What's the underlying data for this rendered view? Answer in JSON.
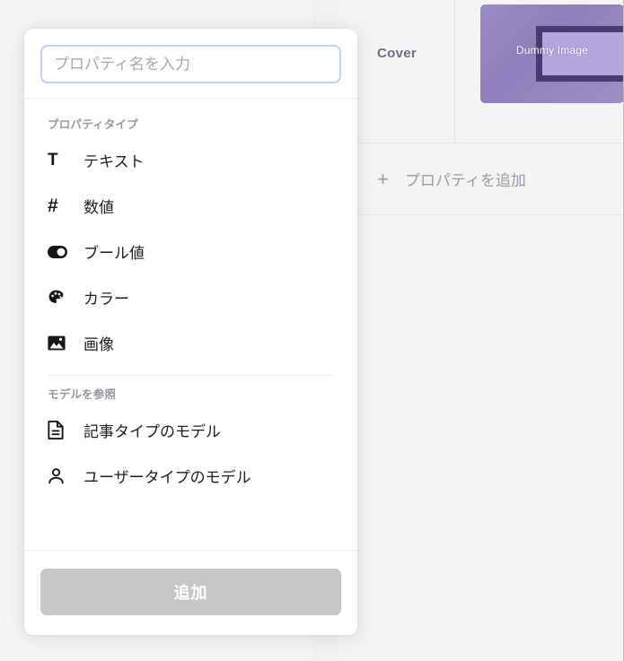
{
  "background": {
    "cover_row": {
      "label": "Cover",
      "image_caption": "Dummy Image"
    },
    "add_property_row": {
      "plus": "+",
      "label": "プロパティを追加"
    }
  },
  "popover": {
    "search": {
      "value": "",
      "placeholder": "プロパティ名を入力"
    },
    "groups": [
      {
        "title": "プロパティタイプ",
        "items": [
          {
            "label": "テキスト",
            "icon": "text-t-icon",
            "glyph": "T"
          },
          {
            "label": "数値",
            "icon": "hash-icon",
            "glyph": "#"
          },
          {
            "label": "ブール値",
            "icon": "toggle-icon",
            "glyph": ""
          },
          {
            "label": "カラー",
            "icon": "palette-icon",
            "glyph": ""
          },
          {
            "label": "画像",
            "icon": "image-icon",
            "glyph": ""
          }
        ]
      },
      {
        "title": "モデルを参照",
        "items": [
          {
            "label": "記事タイプのモデル",
            "icon": "document-icon",
            "glyph": ""
          },
          {
            "label": "ユーザータイプのモデル",
            "icon": "person-icon",
            "glyph": ""
          }
        ]
      }
    ],
    "footer": {
      "submit_label": "追加",
      "submit_disabled": true
    }
  },
  "colors": {
    "page_background": "#f4f4f5",
    "panel_background": "#ffffff",
    "input_focus_border": "#bcd6f2",
    "submit_disabled_bg": "#c6c6c8",
    "muted_text": "#97979e",
    "scrollbar_thumb": "#bdbdbd",
    "cover_image_purple": "#9b8cc4"
  }
}
